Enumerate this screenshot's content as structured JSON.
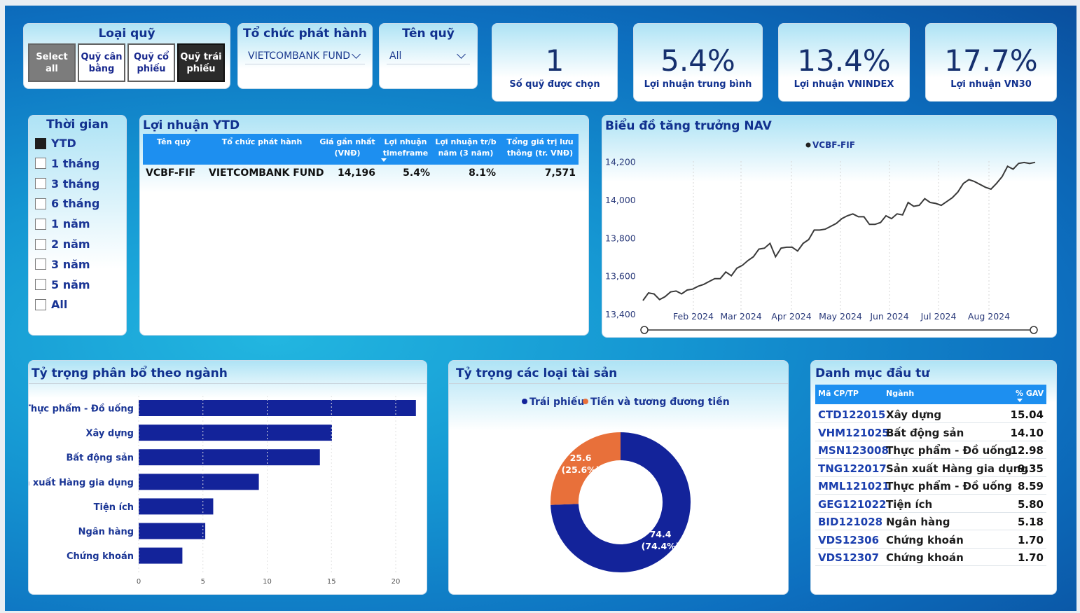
{
  "fund_type": {
    "title": "Loại quỹ",
    "options": [
      {
        "label": "Select all",
        "state": "selected"
      },
      {
        "label": "Quỹ cân bằng",
        "state": "unselected"
      },
      {
        "label": "Quỹ cổ phiếu",
        "state": "unselected"
      },
      {
        "label": "Quỹ trái phiếu",
        "state": "active"
      }
    ]
  },
  "issuer": {
    "title": "Tổ chức phát hành",
    "value": "VIETCOMBANK FUND"
  },
  "fund_name": {
    "title": "Tên quỹ",
    "value": "All"
  },
  "kpis": [
    {
      "value": "1",
      "label": "Số quỹ được chọn"
    },
    {
      "value": "5.4%",
      "label": "Lợi nhuận trung bình"
    },
    {
      "value": "13.4%",
      "label": "Lợi nhuận VNINDEX"
    },
    {
      "value": "17.7%",
      "label": "Lợi nhuận VN30"
    }
  ],
  "time": {
    "title": "Thời gian",
    "options": [
      {
        "label": "YTD",
        "checked": true
      },
      {
        "label": "1 tháng",
        "checked": false
      },
      {
        "label": "3 tháng",
        "checked": false
      },
      {
        "label": "6 tháng",
        "checked": false
      },
      {
        "label": "1 năm",
        "checked": false
      },
      {
        "label": "2 năm",
        "checked": false
      },
      {
        "label": "3 năm",
        "checked": false
      },
      {
        "label": "5 năm",
        "checked": false
      },
      {
        "label": "All",
        "checked": false
      }
    ]
  },
  "ytd_table": {
    "title": "Lợi nhuận YTD",
    "columns": [
      "Tên quỹ",
      "Tổ chức phát hành",
      "Giá gần nhất (VNĐ)",
      "Lợi nhuận timeframe",
      "Lợi nhuận tr/b năm (3 năm)",
      "Tổng giá trị lưu thông (tr. VNĐ)"
    ],
    "rows": [
      [
        "VCBF-FIF",
        "VIETCOMBANK FUND",
        "14,196",
        "5.4%",
        "8.1%",
        "7,571"
      ]
    ]
  },
  "nav_chart": {
    "title": "Biểu đồ tăng trưởng NAV",
    "legend": "VCBF-FIF"
  },
  "sector_chart": {
    "title": "Tỷ trọng phân bổ theo ngành"
  },
  "asset_chart": {
    "title": "Tỷ trọng các loại tài sản",
    "legend": [
      "Trái phiếu",
      "Tiền và tương đương tiền"
    ],
    "labels": [
      {
        "value": "74.4",
        "pct": "(74.4%)"
      },
      {
        "value": "25.6",
        "pct": "(25.6%)"
      }
    ]
  },
  "holdings": {
    "title": "Danh mục đầu tư",
    "columns": [
      "Mã CP/TP",
      "Ngành",
      "% GAV"
    ],
    "rows": [
      [
        "CTD122015",
        "Xây dựng",
        "15.04"
      ],
      [
        "VHM121025",
        "Bất động sản",
        "14.10"
      ],
      [
        "MSN123008",
        "Thực phẩm - Đồ uống",
        "12.98"
      ],
      [
        "TNG122017",
        "Sản xuất Hàng gia dụng",
        "9.35"
      ],
      [
        "MML121021",
        "Thực phẩm - Đồ uống",
        "8.59"
      ],
      [
        "GEG121022",
        "Tiện ích",
        "5.80"
      ],
      [
        "BID121028",
        "Ngân hàng",
        "5.18"
      ],
      [
        "VDS12306",
        "Chứng khoán",
        "1.70"
      ],
      [
        "VDS12307",
        "Chứng khoán",
        "1.70"
      ]
    ]
  },
  "colors": {
    "navy_bar": "#13239a",
    "orange": "#e8703a",
    "header_blue": "#1d8ff0",
    "line": "#3a3a3a"
  },
  "chart_data": [
    {
      "type": "line",
      "title": "Biểu đồ tăng trưởng NAV",
      "series": [
        {
          "name": "VCBF-FIF",
          "values": [
            13470,
            13510,
            13505,
            13475,
            13490,
            13515,
            13520,
            13505,
            13525,
            13530,
            13545,
            13555,
            13570,
            13585,
            13585,
            13620,
            13600,
            13640,
            13655,
            13680,
            13700,
            13740,
            13745,
            13770,
            13700,
            13745,
            13750,
            13750,
            13730,
            13770,
            13790,
            13840,
            13840,
            13845,
            13860,
            13875,
            13900,
            13915,
            13925,
            13910,
            13910,
            13870,
            13870,
            13880,
            13915,
            13900,
            13925,
            13920,
            13985,
            13965,
            13970,
            14005,
            13985,
            13980,
            13970,
            13990,
            14010,
            14040,
            14085,
            14105,
            14095,
            14080,
            14065,
            14055,
            14085,
            14120,
            14175,
            14160,
            14190,
            14195,
            14190,
            14196
          ]
        }
      ],
      "x_ticks": [
        "Feb 2024",
        "Mar 2024",
        "Apr 2024",
        "May 2024",
        "Jun 2024",
        "Jul 2024",
        "Aug 2024"
      ],
      "y_ticks": [
        "13,400",
        "13,600",
        "13,800",
        "14,000",
        "14,200"
      ],
      "ylim": [
        13400,
        14250
      ]
    },
    {
      "type": "bar",
      "orientation": "horizontal",
      "title": "Tỷ trọng phân bổ theo ngành",
      "categories": [
        "Thực phẩm - Đồ uống",
        "Xây dựng",
        "Bất động sản",
        "Sản xuất Hàng gia dụng",
        "Tiện ích",
        "Ngân hàng",
        "Chứng khoán"
      ],
      "values": [
        21.57,
        15.04,
        14.1,
        9.35,
        5.8,
        5.18,
        3.4
      ],
      "x_ticks": [
        "0",
        "5",
        "10",
        "15",
        "20"
      ],
      "xlim": [
        0,
        22
      ]
    },
    {
      "type": "pie",
      "style": "donut",
      "title": "Tỷ trọng các loại tài sản",
      "categories": [
        "Trái phiếu",
        "Tiền và tương đương tiền"
      ],
      "values": [
        74.4,
        25.6
      ]
    }
  ]
}
